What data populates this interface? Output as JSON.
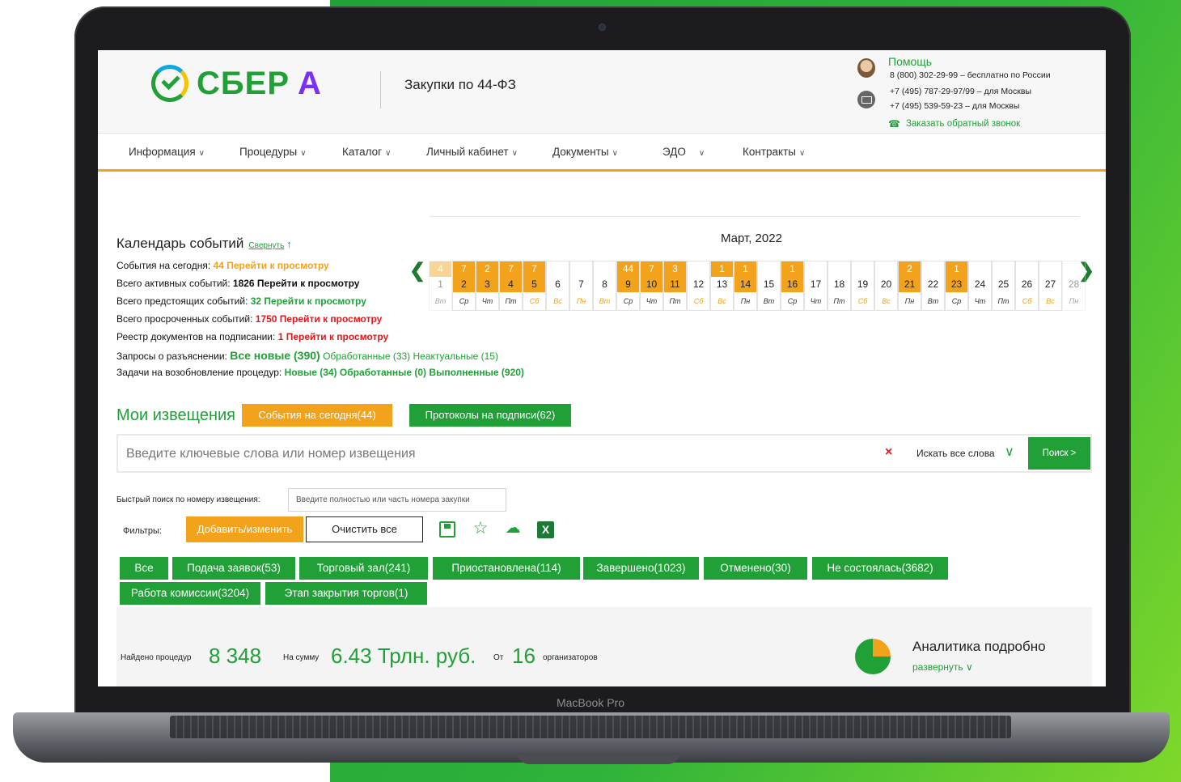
{
  "device": {
    "label": "MacBook Pro"
  },
  "header": {
    "logo_text": "СБЕР",
    "logo_suffix": "А",
    "section_title": "Закупки по 44-ФЗ",
    "help_label": "Помощь",
    "phones": [
      "8 (800) 302-29-99 – бесплатно по России",
      "+7 (495) 787-29-97/99 – для Москвы",
      "+7 (495) 539-59-23 – для Москвы"
    ],
    "callback_label": "Заказать обратный звонок"
  },
  "nav": {
    "items": [
      "Информация",
      "Процедуры",
      "Каталог",
      "Личный кабинет",
      "Документы",
      "ЭДО",
      "Контракты"
    ]
  },
  "calendar": {
    "title": "Календарь событий",
    "collapse_label": "Свернуть",
    "month": "Март, 2022",
    "days": [
      {
        "n": "1",
        "w": "Вт",
        "ev": "4",
        "we": false,
        "hl": false
      },
      {
        "n": "2",
        "w": "Ср",
        "ev": "7",
        "we": false,
        "hl": true
      },
      {
        "n": "3",
        "w": "Чт",
        "ev": "2",
        "we": false,
        "hl": true
      },
      {
        "n": "4",
        "w": "Пт",
        "ev": "7",
        "we": false,
        "hl": true
      },
      {
        "n": "5",
        "w": "Сб",
        "ev": "7",
        "we": true,
        "hl": true
      },
      {
        "n": "6",
        "w": "Вс",
        "ev": "",
        "we": true,
        "hl": false
      },
      {
        "n": "7",
        "w": "Пн",
        "ev": "",
        "we": true,
        "hl": false
      },
      {
        "n": "8",
        "w": "Вт",
        "ev": "",
        "we": true,
        "hl": false
      },
      {
        "n": "9",
        "w": "Ср",
        "ev": "44",
        "we": false,
        "hl": true
      },
      {
        "n": "10",
        "w": "Чт",
        "ev": "7",
        "we": false,
        "hl": true
      },
      {
        "n": "11",
        "w": "Пт",
        "ev": "3",
        "we": false,
        "hl": true
      },
      {
        "n": "12",
        "w": "Сб",
        "ev": "",
        "we": true,
        "hl": false
      },
      {
        "n": "13",
        "w": "Вс",
        "ev": "1",
        "we": true,
        "hl": false
      },
      {
        "n": "14",
        "w": "Пн",
        "ev": "1",
        "we": false,
        "hl": true
      },
      {
        "n": "15",
        "w": "Вт",
        "ev": "",
        "we": false,
        "hl": false
      },
      {
        "n": "16",
        "w": "Ср",
        "ev": "1",
        "we": false,
        "hl": true
      },
      {
        "n": "17",
        "w": "Чт",
        "ev": "",
        "we": false,
        "hl": false
      },
      {
        "n": "18",
        "w": "Пт",
        "ev": "",
        "we": false,
        "hl": false
      },
      {
        "n": "19",
        "w": "Сб",
        "ev": "",
        "we": true,
        "hl": false
      },
      {
        "n": "20",
        "w": "Вс",
        "ev": "",
        "we": true,
        "hl": false
      },
      {
        "n": "21",
        "w": "Пн",
        "ev": "2",
        "we": false,
        "hl": true
      },
      {
        "n": "22",
        "w": "Вт",
        "ev": "",
        "we": false,
        "hl": false
      },
      {
        "n": "23",
        "w": "Ср",
        "ev": "1",
        "we": false,
        "hl": true
      },
      {
        "n": "24",
        "w": "Чт",
        "ev": "",
        "we": false,
        "hl": false
      },
      {
        "n": "25",
        "w": "Пт",
        "ev": "",
        "we": false,
        "hl": false
      },
      {
        "n": "26",
        "w": "Сб",
        "ev": "",
        "we": true,
        "hl": false
      },
      {
        "n": "27",
        "w": "Вс",
        "ev": "",
        "we": true,
        "hl": false
      },
      {
        "n": "28",
        "w": "Пн",
        "ev": "",
        "we": false,
        "hl": false
      }
    ]
  },
  "events": {
    "today_label": "События на сегодня:",
    "today_value": "44 Перейти к просмотру",
    "active_label": "Всего активных событий:",
    "active_value": "1826 Перейти к просмотру",
    "upcoming_label": "Всего предстоящих событий:",
    "upcoming_value": "32 Перейти к просмотру",
    "overdue_label": "Всего просроченных событий:",
    "overdue_value": "1750 Перейти к просмотру",
    "registry_label": "Реестр документов на подписании:",
    "registry_value": "1 Перейти к просмотру",
    "clarify_label": "Запросы о разъяснении:",
    "clarify_new": "Все новые (390)",
    "clarify_processed": "Обработанные (33)",
    "clarify_irrelevant": "Неактуальные (15)",
    "resume_label": "Задачи на возобновление процедур:",
    "resume_new": "Новые (34)",
    "resume_processed": "Обработанные (0)",
    "resume_done": "Выполненные (920)"
  },
  "notices": {
    "title": "Мои извещения",
    "today_button": "События на сегодня(44)",
    "protocols_button": "Протоколы на подписи(62)",
    "search_placeholder": "Введите ключевые слова или номер извещения",
    "search_mode": "Искать все слова",
    "search_button": "Поиск >",
    "quick_label": "Быстрый поиск по номеру извещения:",
    "quick_placeholder": "Введите полностью или часть номера закупки",
    "filters_label": "Фильтры:",
    "add_filter_button": "Добавить/изменить",
    "clear_button": "Очистить все",
    "status_chips": [
      "Все",
      "Подача заявок(53)",
      "Торговый зал(241)",
      "Приостановлена(114)",
      "Завершено(1023)",
      "Отменено(30)",
      "Не состоялась(3682)",
      "Работа комиссии(3204)",
      "Этап закрытия торгов(1)"
    ]
  },
  "stats": {
    "found_label": "Найдено процедур",
    "found_value": "8 348",
    "sum_label": "На сумму",
    "sum_value": "6.43 Трлн. руб.",
    "from_label": "От",
    "orgs_value": "16",
    "orgs_label": "организаторов",
    "analytics_title": "Аналитика подробно",
    "analytics_toggle": "развернуть"
  },
  "colors": {
    "brand_green": "#21a038",
    "accent_orange": "#f2a21b",
    "alert_red": "#e0181b"
  }
}
